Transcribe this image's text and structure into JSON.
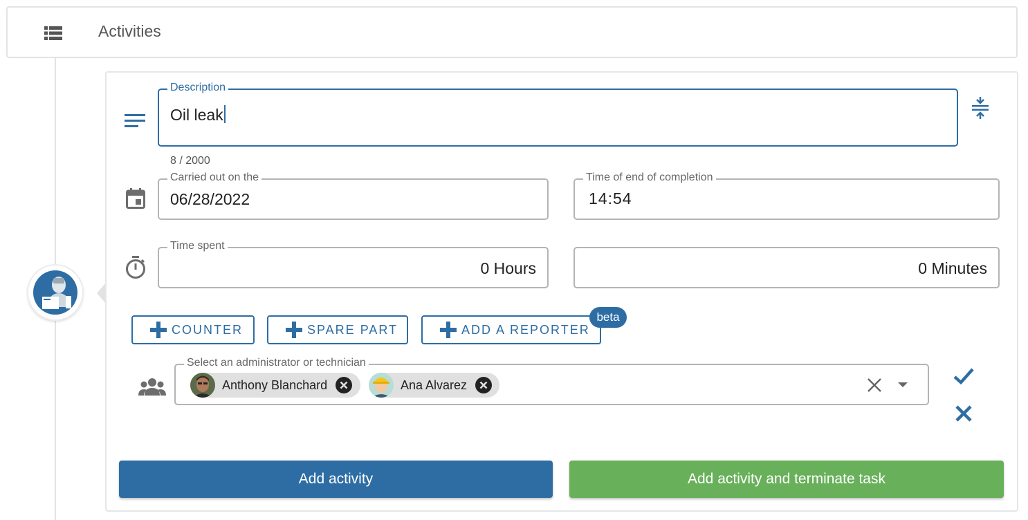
{
  "header": {
    "title": "Activities",
    "icon": "list-icon"
  },
  "form": {
    "description": {
      "label": "Description",
      "value": "Oil leak",
      "counter": "8 / 2000"
    },
    "carried_out": {
      "label": "Carried out on the",
      "value": "06/28/2022"
    },
    "end_time": {
      "label": "Time of end of completion",
      "value": "14:54"
    },
    "time_spent": {
      "label": "Time spent",
      "hours": "0 Hours",
      "minutes": "0 Minutes"
    },
    "buttons": {
      "counter": "COUNTER",
      "spare_part": "SPARE PART",
      "add_reporter": "ADD A REPORTER",
      "beta": "beta"
    },
    "assignees": {
      "label": "Select an administrator or technician",
      "chips": [
        {
          "name": "Anthony Blanchard"
        },
        {
          "name": "Ana Alvarez"
        }
      ]
    },
    "actions": {
      "add_activity": "Add activity",
      "add_and_terminate": "Add activity and terminate task"
    }
  },
  "colors": {
    "primary": "#2e6da4",
    "success": "#68b05a",
    "border": "#b4b4b4"
  }
}
